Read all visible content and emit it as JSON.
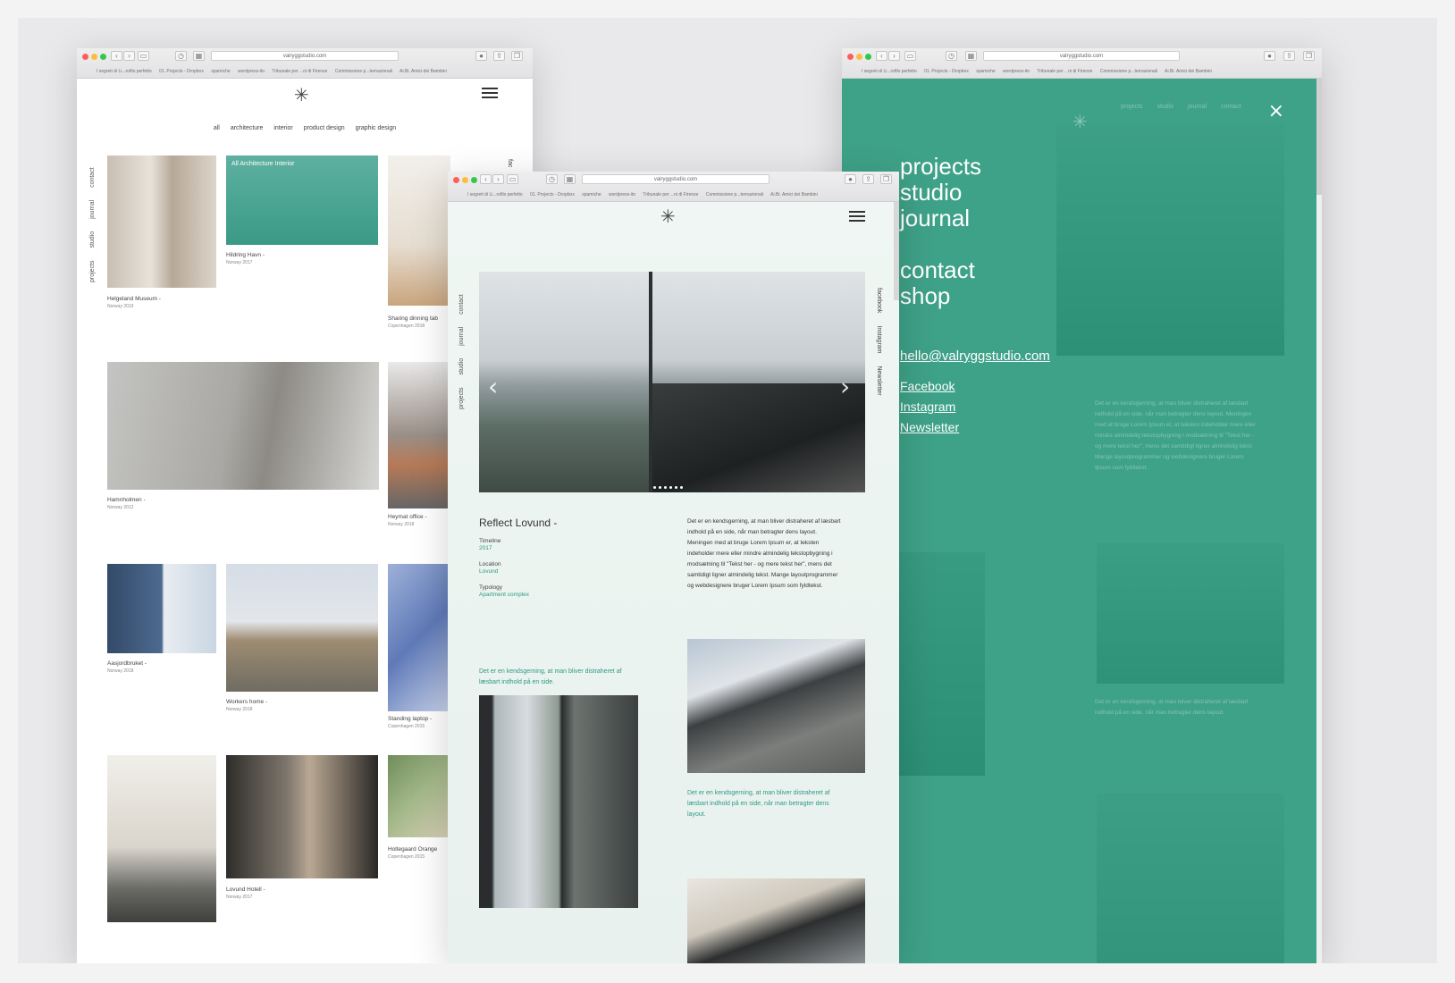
{
  "browser": {
    "url": "valryggstudio.com",
    "bookmarks": [
      "I segreti di Li...rofilo perfetto",
      "01. Projects - Dropbox",
      "spamiche",
      "wordpress-ito",
      "Tribunale per ...ni di Firenze",
      "Commissione p...ternazionali",
      "Ai.Bi. Amici dei Bambini"
    ]
  },
  "site": {
    "logo_glyph": "✳",
    "nav_vertical": [
      "projects",
      "studio",
      "journal",
      "contact"
    ],
    "social_vertical": [
      "facebook",
      "Instagram",
      "Newsletter"
    ],
    "social_partial": "fac"
  },
  "grid": {
    "filters": [
      "all",
      "architecture",
      "interior",
      "product design",
      "graphic design"
    ],
    "hover_label": "All Architecture Interior",
    "items": [
      {
        "name": "Helgeland Museum -",
        "place": "Norway 2019"
      },
      {
        "name": "Hildring Havn -",
        "place": "Norway 2017"
      },
      {
        "name": "Sharing dinning tab",
        "place": "Copenhagen 2018"
      },
      {
        "name": "Hamnholmen -",
        "place": "Norway 2012"
      },
      {
        "name": "Heymat office -",
        "place": "Norway 2018"
      },
      {
        "name": "Aasjordbruket -",
        "place": "Norway 2018"
      },
      {
        "name": "Workers home -",
        "place": "Norway 2018"
      },
      {
        "name": "Standing laptop -",
        "place": "Copenhagen 2015"
      },
      {
        "name": "Lovund Hotell -",
        "place": "Norway 2017"
      },
      {
        "name": "Holtegaard Orange",
        "place": "Copenhagen 2015"
      }
    ]
  },
  "project": {
    "title": "Reflect Lovund -",
    "timeline_label": "Timeline",
    "timeline_value": "2017",
    "location_label": "Location",
    "location_value": "Lovund",
    "typology_label": "Typology",
    "typology_value": "Apartment complex",
    "body": "Det er en kendsgerning, at man bliver distraheret af læsbart indhold på en side, når man betragter dens layout. Meningen med at bruge Lorem Ipsum er, at teksten indeholder mere eller mindre almindelig tekstopbygning i modsætning til \"Tekst her - og mere tekst her\", mens det samtidigt ligner almindelig tekst. Mange layoutprogrammer og webdesignere bruger Lorem Ipsum som fyldtekst.",
    "quote_left": "Det er en kendsgerning, at man bliver distraheret af læsbart indhold på en side.",
    "quote_right": "Det er en kendsgerning, at man bliver distraheret af læsbart indhold på en side, når man betragter dens layout.",
    "prev_arrow": "‹",
    "next_arrow": "›"
  },
  "menu": {
    "items": [
      "projects",
      "studio",
      "journal"
    ],
    "items2": [
      "contact",
      "shop"
    ],
    "email": "hello@valryggstudio.com",
    "social": [
      "Facebook",
      "Instagram",
      "Newsletter"
    ],
    "close": "×",
    "top_nav": [
      "projects",
      "studio",
      "journal",
      "contact"
    ]
  },
  "colors": {
    "teal": "#26967a",
    "teal_text": "#2e9a82"
  }
}
